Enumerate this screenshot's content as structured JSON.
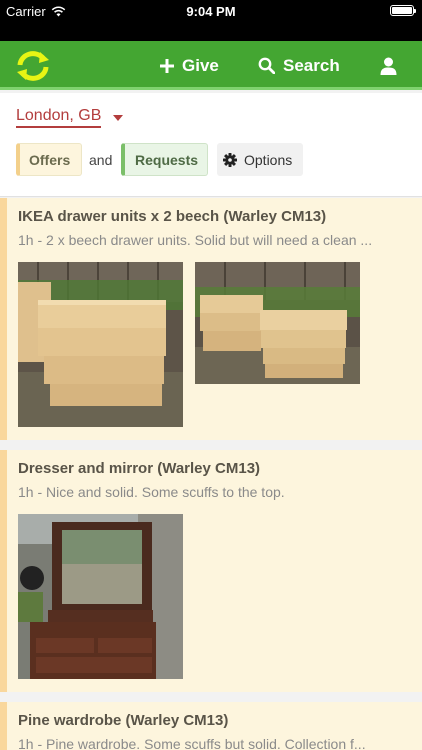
{
  "status_bar": {
    "carrier": "Carrier",
    "time": "9:04 PM"
  },
  "nav": {
    "give_label": "Give",
    "search_label": "Search"
  },
  "location": {
    "label": "London, GB"
  },
  "filters": {
    "offers_label": "Offers",
    "and_label": "and",
    "requests_label": "Requests",
    "options_label": "Options"
  },
  "listings": [
    {
      "title": "IKEA drawer units x 2 beech (Warley CM13)",
      "description": "1h - 2 x beech drawer units. Solid but will need a clean ..."
    },
    {
      "title": "Dresser and mirror (Warley CM13)",
      "description": "1h - Nice and solid. Some scuffs to the top."
    },
    {
      "title": "Pine wardrobe (Warley CM13)",
      "description": "1h - Pine wardrobe. Some scuffs but solid. Collection f..."
    }
  ],
  "colors": {
    "brand_green": "#44a632",
    "location_red": "#b33d3d",
    "offer_bg": "#fdf5dd"
  }
}
